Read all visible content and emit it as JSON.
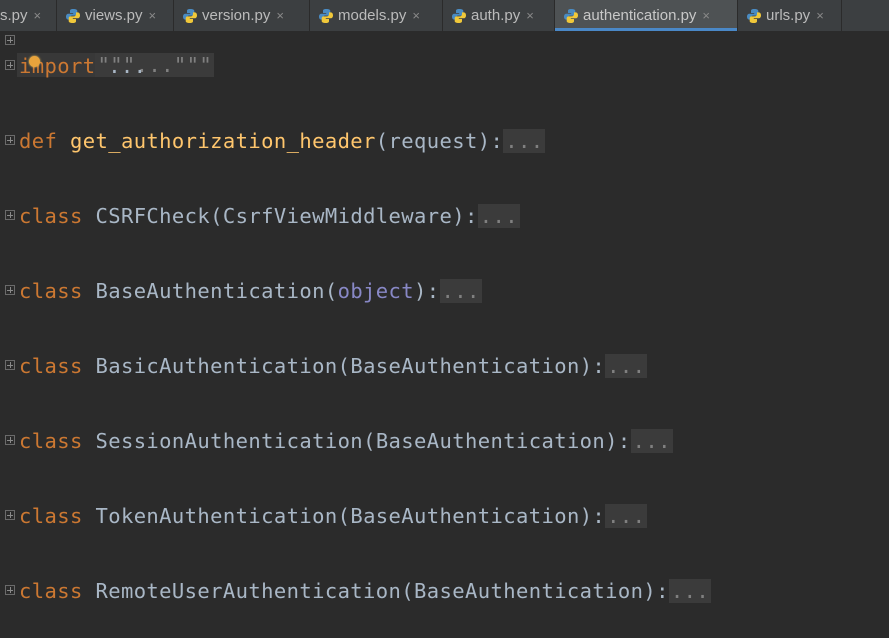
{
  "tabs": [
    {
      "label": "s.py",
      "close": "×",
      "active": false
    },
    {
      "label": "views.py",
      "close": "×",
      "active": false
    },
    {
      "label": "version.py",
      "close": "×",
      "active": false
    },
    {
      "label": "models.py",
      "close": "×",
      "active": false
    },
    {
      "label": "auth.py",
      "close": "×",
      "active": false
    },
    {
      "label": "authentication.py",
      "close": "×",
      "active": true
    },
    {
      "label": "urls.py",
      "close": "×",
      "active": false
    }
  ],
  "editor": {
    "docstring": "\"\"\"...\"\"\"",
    "import_kw": "import",
    "import_rest": " ...",
    "lines": [
      {
        "kw": "def",
        "name": "get_authorization_header",
        "open": "(",
        "arg": "request",
        "close": "):",
        "fold": "..."
      },
      {
        "kw": "class",
        "name": "CSRFCheck",
        "open": "(",
        "arg": "CsrfViewMiddleware",
        "close": "):",
        "fold": "..."
      },
      {
        "kw": "class",
        "name": "BaseAuthentication",
        "open": "(",
        "arg": "object",
        "close": "):",
        "fold": "..."
      },
      {
        "kw": "class",
        "name": "BasicAuthentication",
        "open": "(",
        "arg": "BaseAuthentication",
        "close": "):",
        "fold": "..."
      },
      {
        "kw": "class",
        "name": "SessionAuthentication",
        "open": "(",
        "arg": "BaseAuthentication",
        "close": "):",
        "fold": "..."
      },
      {
        "kw": "class",
        "name": "TokenAuthentication",
        "open": "(",
        "arg": "BaseAuthentication",
        "close": "):",
        "fold": "..."
      },
      {
        "kw": "class",
        "name": "RemoteUserAuthentication",
        "open": "(",
        "arg": "BaseAuthentication",
        "close": "):",
        "fold": "..."
      }
    ]
  },
  "colors": {
    "background": "#2b2b2b",
    "keyword": "#cc7832",
    "function": "#ffc66d",
    "text": "#a9b7c6",
    "builtin": "#8888c6",
    "tab_accent": "#4a88c7"
  }
}
